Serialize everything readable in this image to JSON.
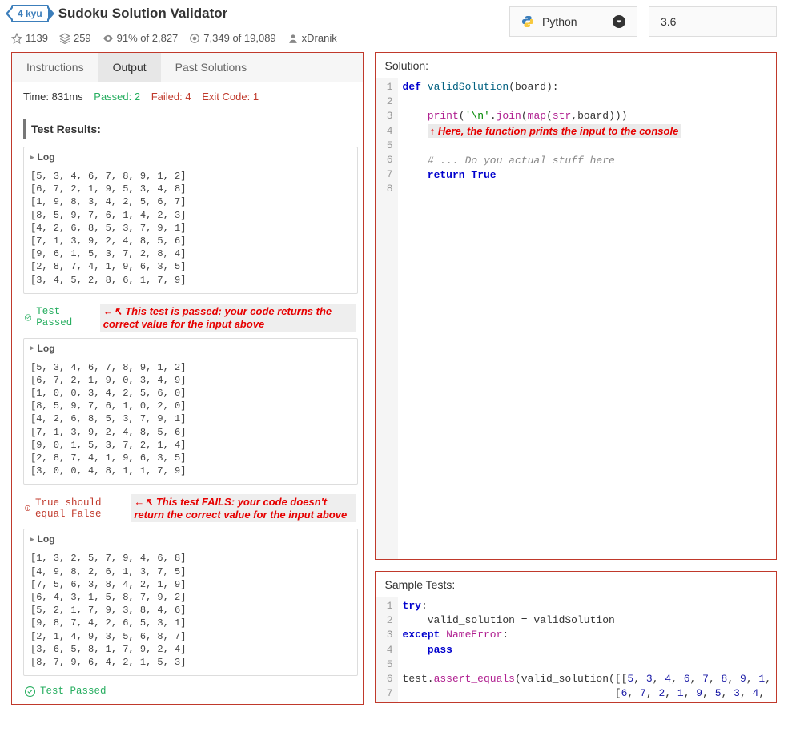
{
  "header": {
    "kyu": "4 kyu",
    "title": "Sudoku Solution Validator",
    "stars": "1139",
    "collections": "259",
    "satisfaction": "91% of 2,827",
    "completions": "7,349 of 19,089",
    "author": "xDranik"
  },
  "lang": {
    "name": "Python",
    "version": "3.6"
  },
  "left": {
    "tabs": {
      "instructions": "Instructions",
      "output": "Output",
      "past": "Past Solutions"
    },
    "summary": {
      "time": "Time: 831ms",
      "passed": "Passed: 2",
      "failed": "Failed: 4",
      "exit": "Exit Code: 1"
    },
    "results_title": "Test Results:",
    "log_label": "Log",
    "log1": "[5, 3, 4, 6, 7, 8, 9, 1, 2]\n[6, 7, 2, 1, 9, 5, 3, 4, 8]\n[1, 9, 8, 3, 4, 2, 5, 6, 7]\n[8, 5, 9, 7, 6, 1, 4, 2, 3]\n[4, 2, 6, 8, 5, 3, 7, 9, 1]\n[7, 1, 3, 9, 2, 4, 8, 5, 6]\n[9, 6, 1, 5, 3, 7, 2, 8, 4]\n[2, 8, 7, 4, 1, 9, 6, 3, 5]\n[3, 4, 5, 2, 8, 6, 1, 7, 9]",
    "pass_text": "Test Passed",
    "annot_pass": "←↖ This test is passed: your code returns the correct value for the input above",
    "log2": "[5, 3, 4, 6, 7, 8, 9, 1, 2]\n[6, 7, 2, 1, 9, 0, 3, 4, 9]\n[1, 0, 0, 3, 4, 2, 5, 6, 0]\n[8, 5, 9, 7, 6, 1, 0, 2, 0]\n[4, 2, 6, 8, 5, 3, 7, 9, 1]\n[7, 1, 3, 9, 2, 4, 8, 5, 6]\n[9, 0, 1, 5, 3, 7, 2, 1, 4]\n[2, 8, 7, 4, 1, 9, 6, 3, 5]\n[3, 0, 0, 4, 8, 1, 1, 7, 9]",
    "fail_text": "True should equal False",
    "annot_fail": "←↖ This test FAILS:  your code doesn't return the correct value for the input above",
    "log3": "[1, 3, 2, 5, 7, 9, 4, 6, 8]\n[4, 9, 8, 2, 6, 1, 3, 7, 5]\n[7, 5, 6, 3, 8, 4, 2, 1, 9]\n[6, 4, 3, 1, 5, 8, 7, 9, 2]\n[5, 2, 1, 7, 9, 3, 8, 4, 6]\n[9, 8, 7, 4, 2, 6, 5, 3, 1]\n[2, 1, 4, 9, 3, 5, 6, 8, 7]\n[3, 6, 5, 8, 1, 7, 9, 2, 4]\n[8, 7, 9, 6, 4, 2, 1, 5, 3]"
  },
  "solution": {
    "title": "Solution:",
    "annot": "↑ Here, the function prints the input to the console"
  },
  "tests": {
    "title": "Sample Tests:"
  }
}
